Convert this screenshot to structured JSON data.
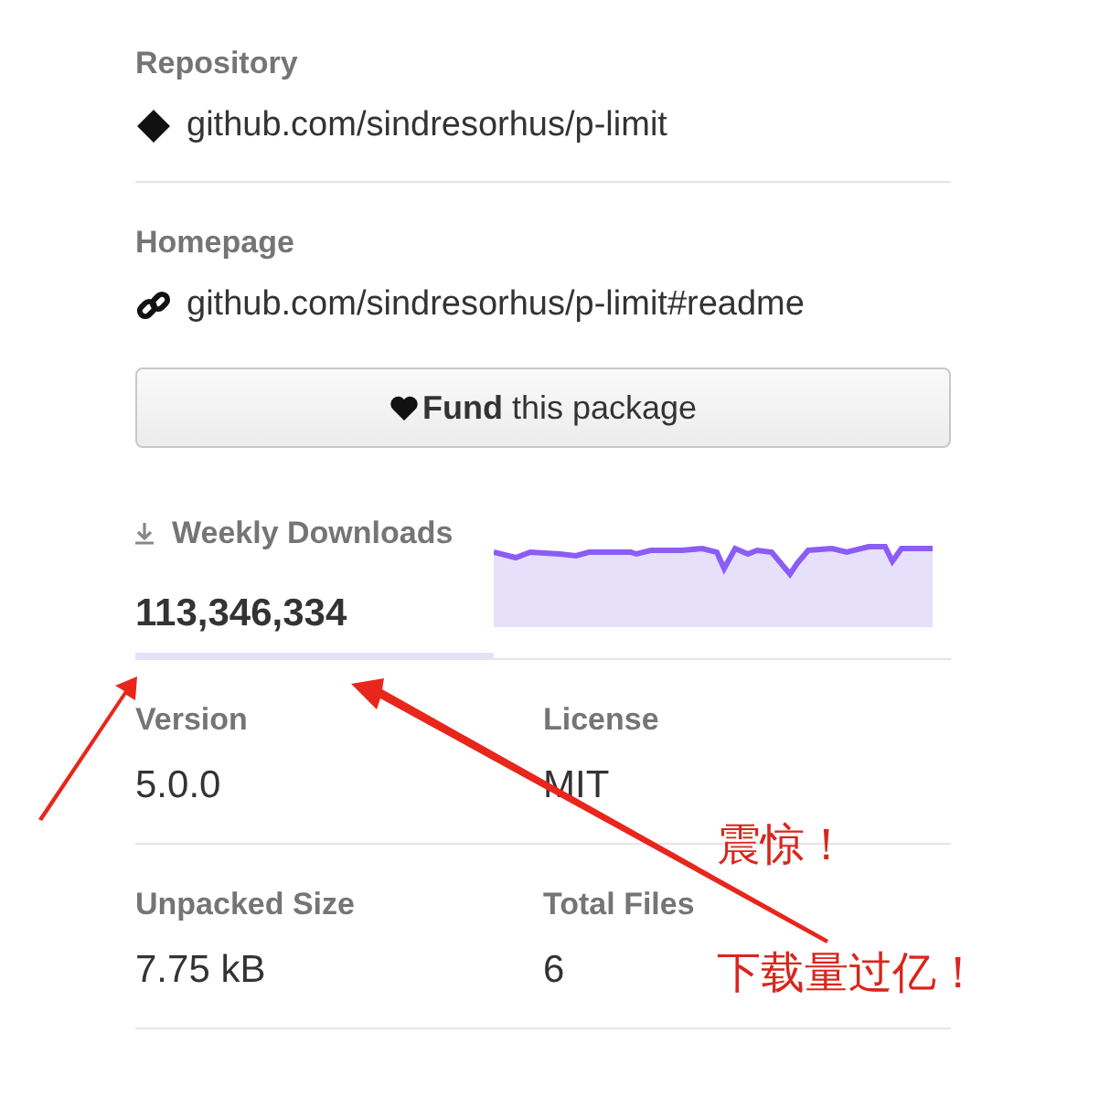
{
  "repository": {
    "label": "Repository",
    "link": "github.com/sindresorhus/p-limit"
  },
  "homepage": {
    "label": "Homepage",
    "link": "github.com/sindresorhus/p-limit#readme"
  },
  "fund_button": "**Fund** this package",
  "weekly_downloads": {
    "label": "Weekly Downloads",
    "count": "113,346,334"
  },
  "stats": [
    {
      "label": "Version",
      "value": "5.0.0"
    },
    {
      "label": "License",
      "value": "MIT"
    },
    {
      "label": "Unpacked Size",
      "value": "7.75 kB"
    },
    {
      "label": "Total Files",
      "value": "6"
    }
  ],
  "annotations": [
    "震惊！",
    "下载量过亿！"
  ]
}
